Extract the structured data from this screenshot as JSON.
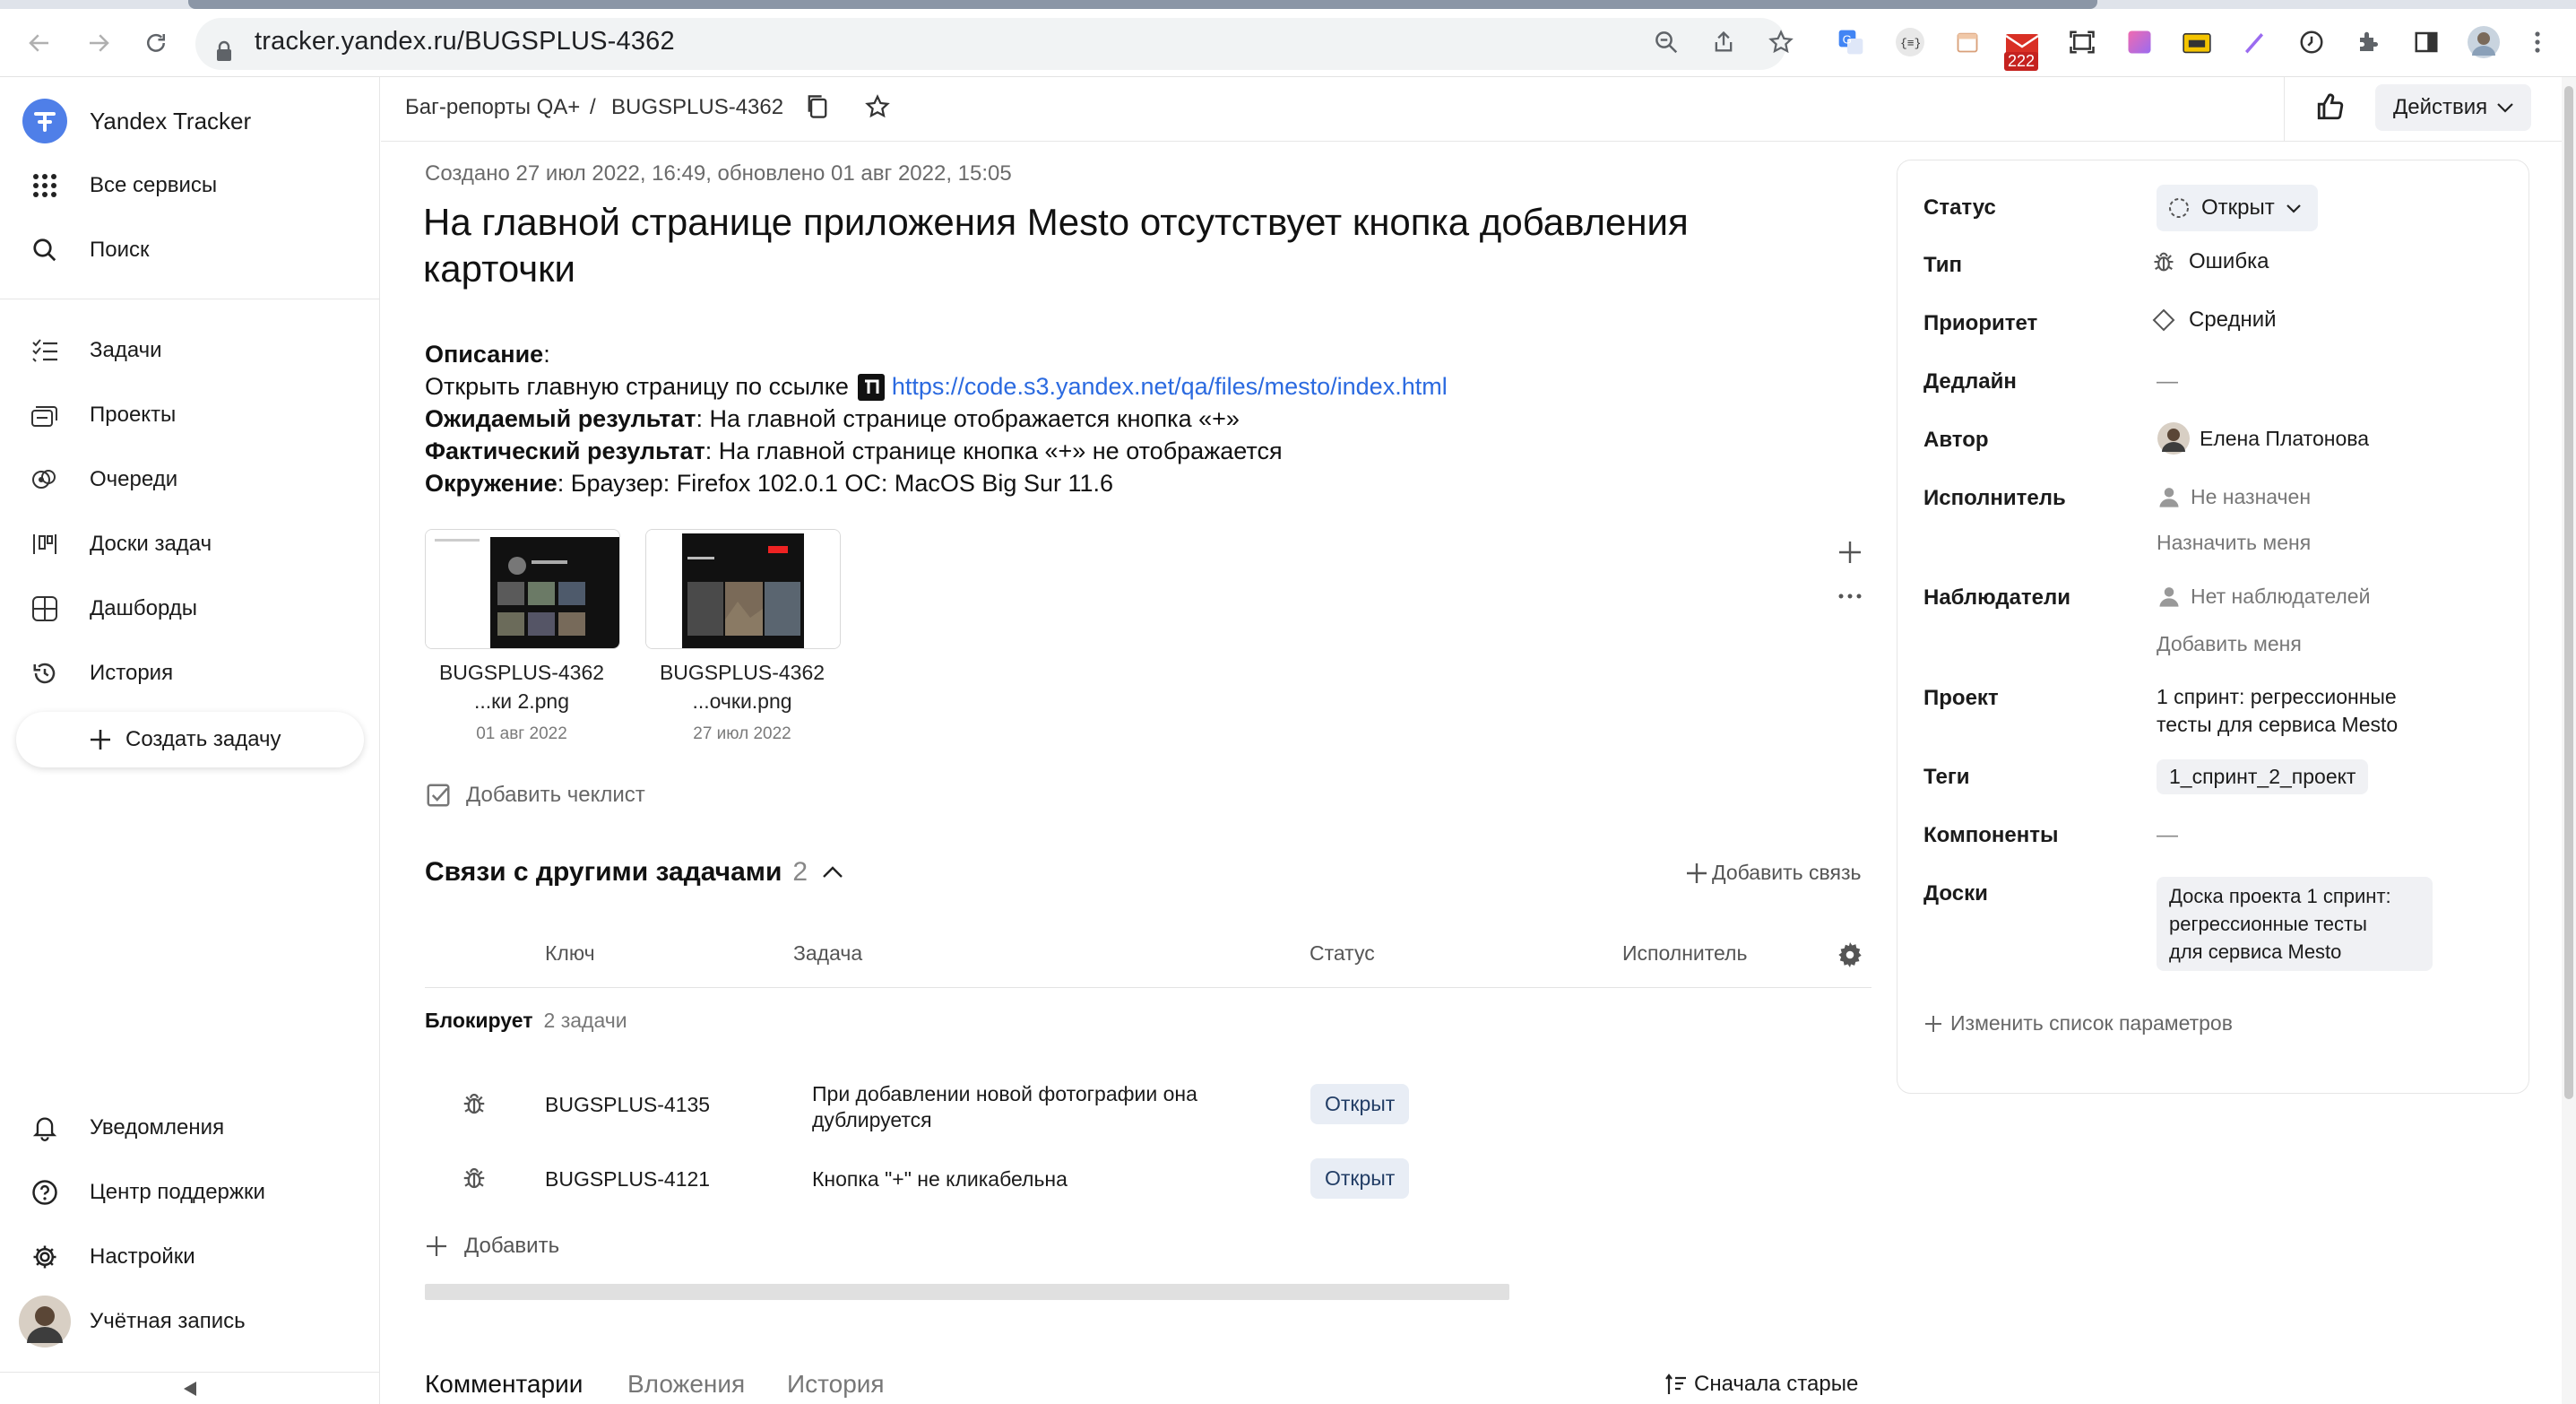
{
  "browser": {
    "url": "tracker.yandex.ru/BUGSPLUS-4362",
    "mail_badge": "222"
  },
  "sidebar": {
    "brand": "Yandex Tracker",
    "all_services": "Все сервисы",
    "search": "Поиск",
    "nav": [
      "Задачи",
      "Проекты",
      "Очереди",
      "Доски задач",
      "Дашборды",
      "История"
    ],
    "create_task": "Создать задачу",
    "bottom": [
      "Уведомления",
      "Центр поддержки",
      "Настройки",
      "Учётная запись"
    ]
  },
  "header": {
    "crumb_queue": "Баг-репорты QA+",
    "crumb_sep": "/",
    "crumb_key": "BUGSPLUS-4362",
    "actions": "Действия"
  },
  "issue": {
    "meta": "Создано 27 июл 2022, 16:49, обновлено 01 авг 2022, 15:05",
    "title": "На главной странице приложения Mesto отсутствует кнопка добавления карточки",
    "desc_label": "Описание",
    "desc_colon": ":",
    "open_text": "Открыть главную страницу по ссылке",
    "link": "https://code.s3.yandex.net/qa/files/mesto/index.html",
    "expected_label": "Ожидаемый результат",
    "expected_text": ": На главной странице отображается кнопка «+»",
    "actual_label": "Фактический результат",
    "actual_text": ": На главной странице кнопка «+» не отображается",
    "env_label": "Окружение",
    "env_text": ": Браузер: Firefox 102.0.1 OC: MacOS Big Sur 11.6"
  },
  "attachments": [
    {
      "name1": "BUGSPLUS-4362",
      "name2": "...ки 2.png",
      "date": "01 авг 2022"
    },
    {
      "name1": "BUGSPLUS-4362",
      "name2": "...очки.png",
      "date": "27 июл 2022"
    }
  ],
  "checklist": "Добавить чеклист",
  "links": {
    "title": "Связи с другими задачами",
    "count": "2",
    "add_link": "Добавить связь",
    "cols": [
      "Ключ",
      "Задача",
      "Статус",
      "Исполнитель"
    ],
    "group_label": "Блокирует",
    "group_count": "2 задачи",
    "rows": [
      {
        "key": "BUGSPLUS-4135",
        "task1": "При добавлении новой фотографии она",
        "task2": "дублируется",
        "status": "Открыт"
      },
      {
        "key": "BUGSPLUS-4121",
        "task1": "Кнопка \"+\" не кликабельна",
        "task2": "",
        "status": "Открыт"
      }
    ],
    "add": "Добавить"
  },
  "bottom_tabs": [
    "Комментарии",
    "Вложения",
    "История"
  ],
  "sort": "Сначала старые",
  "panel": {
    "status_label": "Статус",
    "status_value": "Открыт",
    "type_label": "Тип",
    "type_value": "Ошибка",
    "priority_label": "Приоритет",
    "priority_value": "Средний",
    "deadline_label": "Дедлайн",
    "deadline_value": "—",
    "author_label": "Автор",
    "author_value": "Елена Платонова",
    "assignee_label": "Исполнитель",
    "assignee_value": "Не назначен",
    "assign_me": "Назначить меня",
    "watchers_label": "Наблюдатели",
    "watchers_value": "Нет наблюдателей",
    "add_me": "Добавить меня",
    "project_label": "Проект",
    "project_value1": "1 спринт: регрессионные",
    "project_value2": "тесты для сервиса Mesto",
    "tags_label": "Теги",
    "tags_value": "1_спринт_2_проект",
    "components_label": "Компоненты",
    "components_value": "—",
    "boards_label": "Доски",
    "boards_value1": "Доска проекта 1 спринт:",
    "boards_value2": "регрессионные тесты",
    "boards_value3": "для сервиса Mesto",
    "edit_params": "Изменить список параметров"
  },
  "colors": {
    "link": "#2b6ae0",
    "brand": "#4f7fe8",
    "badge_bg": "#e8edf5",
    "mail_red": "#d93025"
  }
}
